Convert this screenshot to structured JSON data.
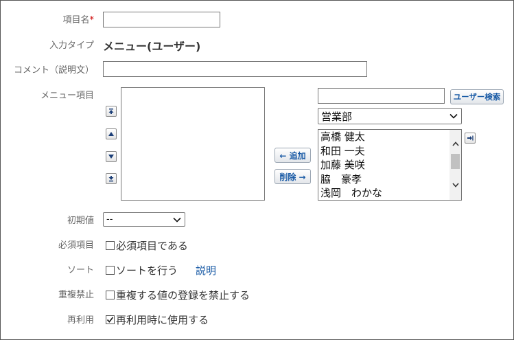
{
  "form": {
    "item_name": {
      "label": "項目名",
      "required_mark": "*",
      "value": ""
    },
    "input_type": {
      "label": "入力タイプ",
      "value": "メニュー(ユーザー)"
    },
    "comment": {
      "label": "コメント（説明文）",
      "value": ""
    },
    "menu_items": {
      "label": "メニュー項目",
      "selected_items": [],
      "add_button": "← 追加",
      "remove_button": "削除 →",
      "search_value": "",
      "search_button": "ユーザー検索",
      "group_select": {
        "selected": "営業部"
      },
      "users": [
        "高橋 健太",
        "和田 一夫",
        "加藤 美咲",
        "脇　豪孝",
        "浅岡　わかな"
      ]
    },
    "initial_value": {
      "label": "初期値",
      "selected": "--"
    },
    "required": {
      "label": "必須項目",
      "checkbox_label": "必須項目である",
      "checked": false
    },
    "sort": {
      "label": "ソート",
      "checkbox_label": "ソートを行う",
      "checked": false,
      "help_link": "説明"
    },
    "no_duplicates": {
      "label": "重複禁止",
      "checkbox_label": "重複する値の登録を禁止する",
      "checked": false
    },
    "reuse": {
      "label": "再利用",
      "checkbox_label": "再利用時に使用する",
      "checked": true
    }
  },
  "colors": {
    "link": "#1a5ba6",
    "required_mark": "#cc0000",
    "label": "#666666"
  },
  "icons": {
    "move_top": "arrow-top-icon",
    "move_up": "arrow-up-icon",
    "move_down": "arrow-down-icon",
    "move_bottom": "arrow-bottom-icon",
    "add_all": "arrow-right-bar-icon"
  }
}
